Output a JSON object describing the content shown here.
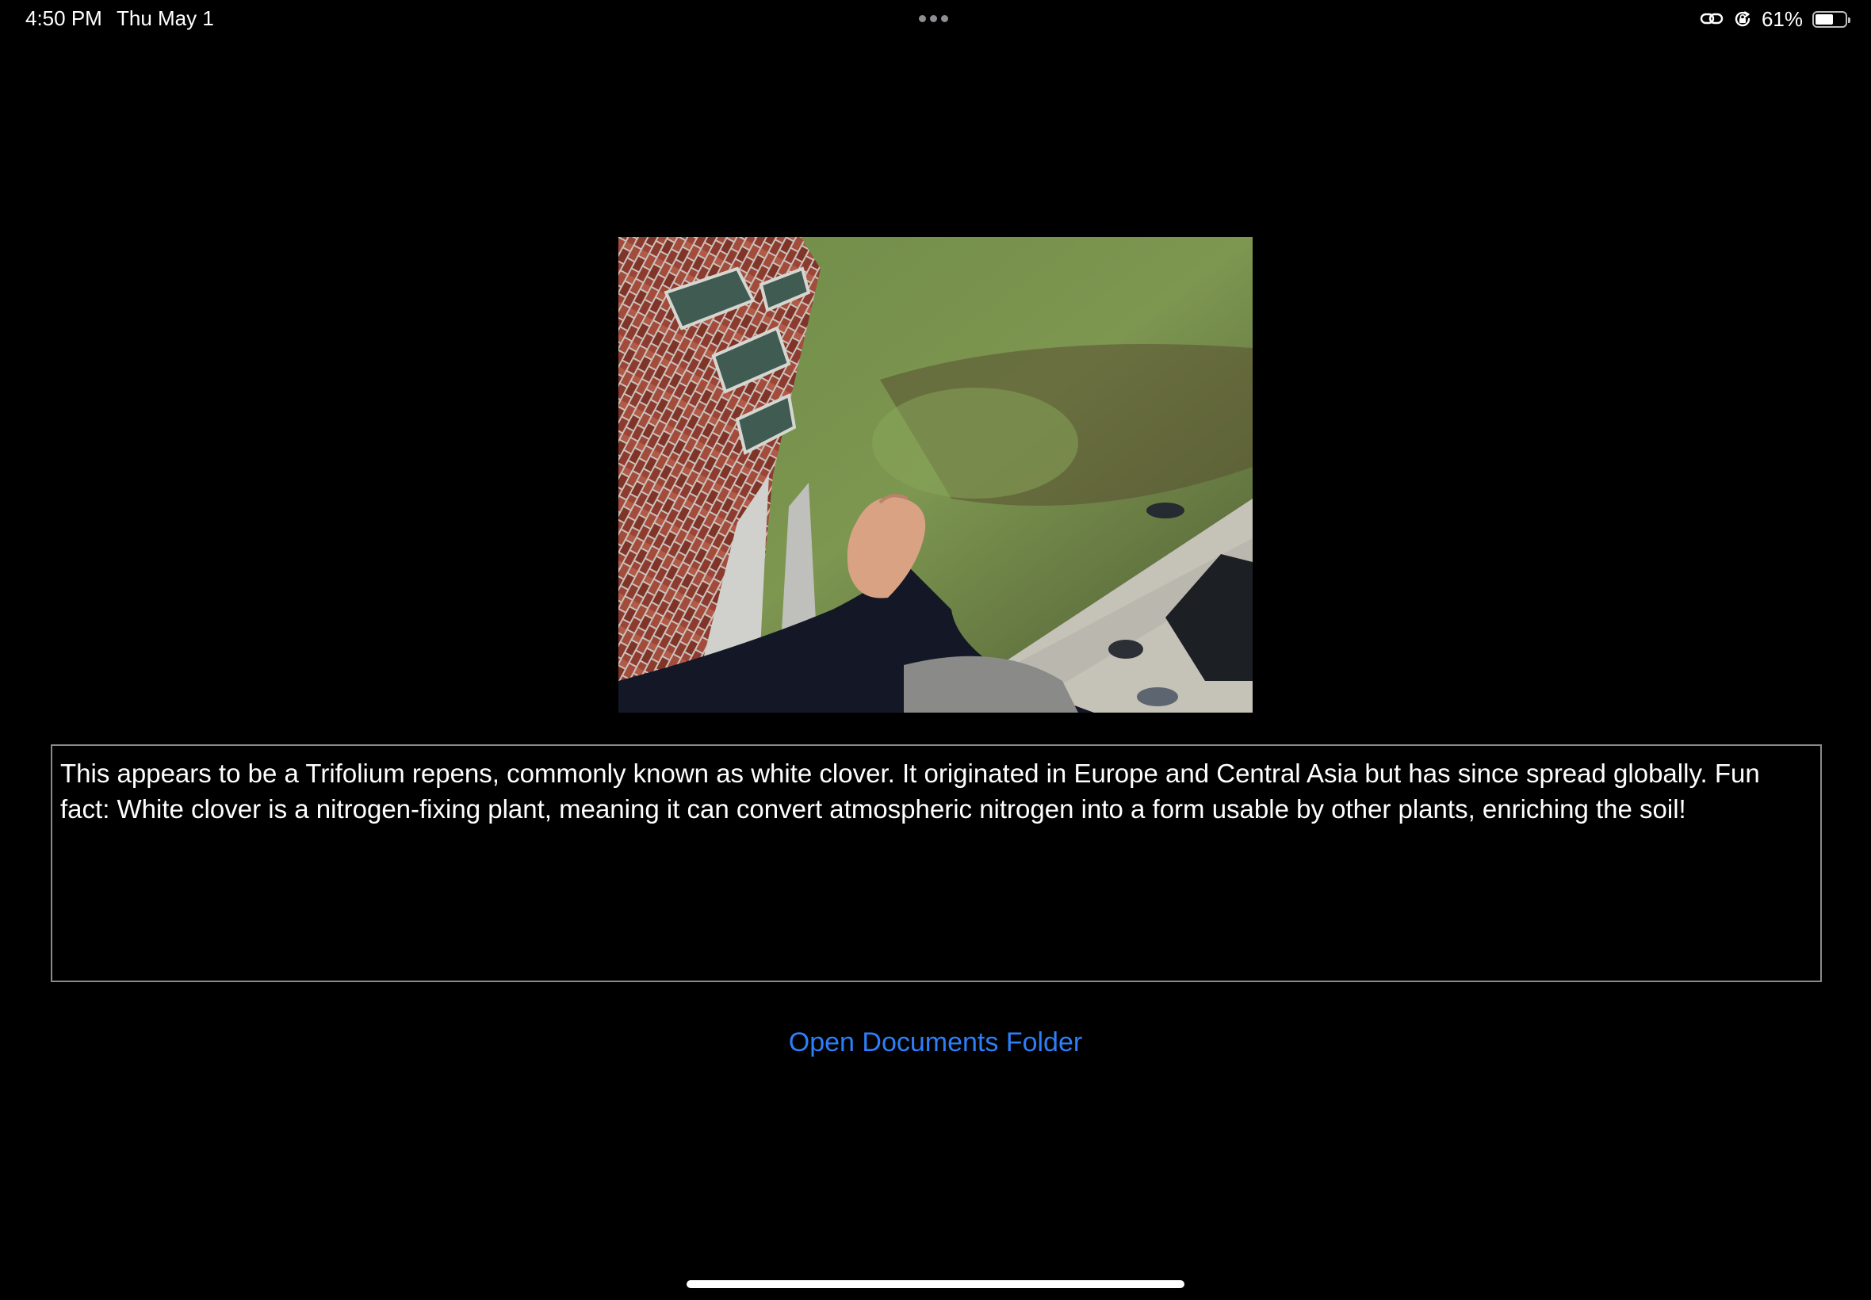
{
  "status_bar": {
    "time": "4:50 PM",
    "date": "Thu May 1",
    "battery_percent_label": "61%",
    "battery_level": 0.61,
    "icons": [
      "link-icon",
      "orientation-lock-icon",
      "battery-icon"
    ]
  },
  "photo": {
    "subject": "clover-camera-photo"
  },
  "result": {
    "text": "This appears to be a Trifolium repens, commonly known as white clover. It originated in Europe and Central Asia but has since spread globally. Fun fact: White clover is a nitrogen-fixing plant, meaning it can convert atmospheric nitrogen into a form usable by other plants, enriching the soil!"
  },
  "actions": {
    "open_documents_label": "Open Documents Folder"
  },
  "colors": {
    "background": "#000000",
    "link": "#2d7ff9",
    "box_border": "#8a8a8a"
  }
}
